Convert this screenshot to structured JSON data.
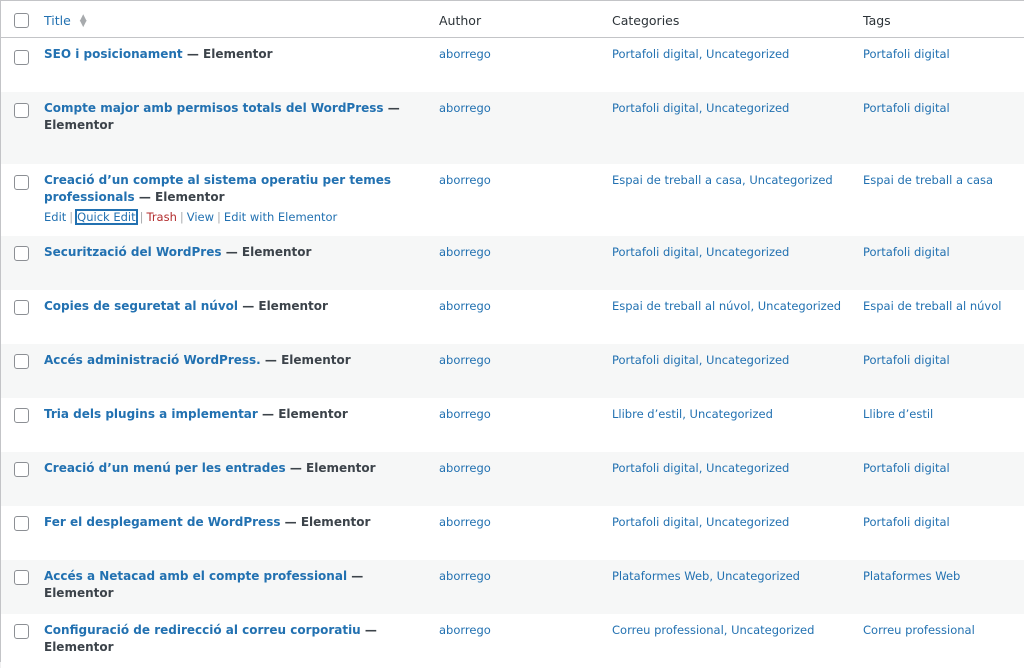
{
  "columns": {
    "title": "Title",
    "author": "Author",
    "categories": "Categories",
    "tags": "Tags"
  },
  "separator": "—",
  "row_actions": {
    "edit": "Edit",
    "quick_edit": "Quick Edit",
    "trash": "Trash",
    "view": "View",
    "edit_with": "Edit with Elementor"
  },
  "rows": [
    {
      "title": "SEO i posicionament",
      "state": "Elementor",
      "author": "aborrego",
      "categories": "Portafoli digital, Uncategorized",
      "tags": "Portafoli digital"
    },
    {
      "title_line1": "Compte major amb permisos totals del WordPress",
      "state": "Elementor",
      "author": "aborrego",
      "categories": "Portafoli digital, Uncategorized",
      "tags": "Portafoli digital"
    },
    {
      "title_line1": "Creació d’un compte al sistema operatiu per temes",
      "title_line2": "professionals",
      "state": "Elementor",
      "author": "aborrego",
      "categories": "Espai de treball a casa, Uncategorized",
      "tags": "Espai de treball a casa"
    },
    {
      "title": "Securització del WordPres",
      "state": "Elementor",
      "author": "aborrego",
      "categories": "Portafoli digital, Uncategorized",
      "tags": "Portafoli digital"
    },
    {
      "title": "Copies de seguretat al núvol",
      "state": "Elementor",
      "author": "aborrego",
      "categories": "Espai de treball al núvol, Uncategorized",
      "tags": "Espai de treball al núvol"
    },
    {
      "title": "Accés administració WordPress.",
      "state": "Elementor",
      "author": "aborrego",
      "categories": "Portafoli digital, Uncategorized",
      "tags": "Portafoli digital"
    },
    {
      "title": "Tria dels plugins a implementar",
      "state": "Elementor",
      "author": "aborrego",
      "categories": "Llibre d’estil, Uncategorized",
      "tags": "Llibre d’estil"
    },
    {
      "title": "Creació d’un menú per les entrades",
      "state": "Elementor",
      "author": "aborrego",
      "categories": "Portafoli digital, Uncategorized",
      "tags": "Portafoli digital"
    },
    {
      "title": "Fer el desplegament de WordPress",
      "state": "Elementor",
      "author": "aborrego",
      "categories": "Portafoli digital, Uncategorized",
      "tags": "Portafoli digital"
    },
    {
      "title": "Accés a Netacad amb el compte professional",
      "state": "Elementor",
      "author": "aborrego",
      "categories": "Plataformes Web, Uncategorized",
      "tags": "Plataformes Web"
    },
    {
      "title": "Configuració de redirecció al correu corporatiu",
      "state": "Elementor",
      "author": "aborrego",
      "categories": "Correu professional, Uncategorized",
      "tags": "Correu professional"
    }
  ]
}
